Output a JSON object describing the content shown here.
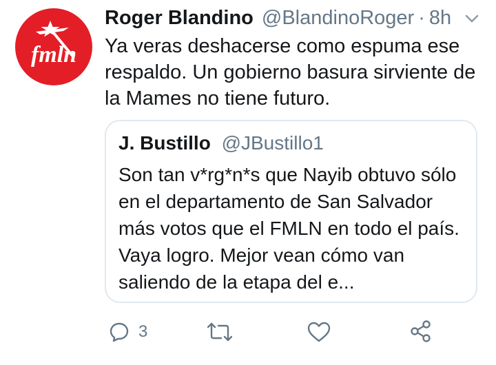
{
  "tweet": {
    "display_name": "Roger Blandino",
    "handle": "@BlandinoRoger",
    "separator": "·",
    "time": "8h",
    "text": "Ya veras deshacerse como espuma ese respaldo. Un gobierno basura sirviente de la Mames no tiene futuro.",
    "avatar_text": "fmln",
    "avatar_icon": "fmln-logo",
    "menu_icon": "chevron-down-icon"
  },
  "quoted": {
    "display_name": "J. Bustillo",
    "handle": "@JBustillo1",
    "text": "Son tan v*rg*n*s que Nayib obtuvo sólo en el departamento de San Salvador más votos que el FMLN en todo el país. Vaya logro. Mejor vean cómo van saliendo de la etapa del e..."
  },
  "actions": {
    "reply_count": "3",
    "reply_icon": "reply-icon",
    "retweet_icon": "retweet-icon",
    "like_icon": "heart-icon",
    "share_icon": "share-icon"
  },
  "colors": {
    "avatar_bg": "#e41e26",
    "secondary_text": "#657786",
    "border": "#e1e8ed"
  }
}
